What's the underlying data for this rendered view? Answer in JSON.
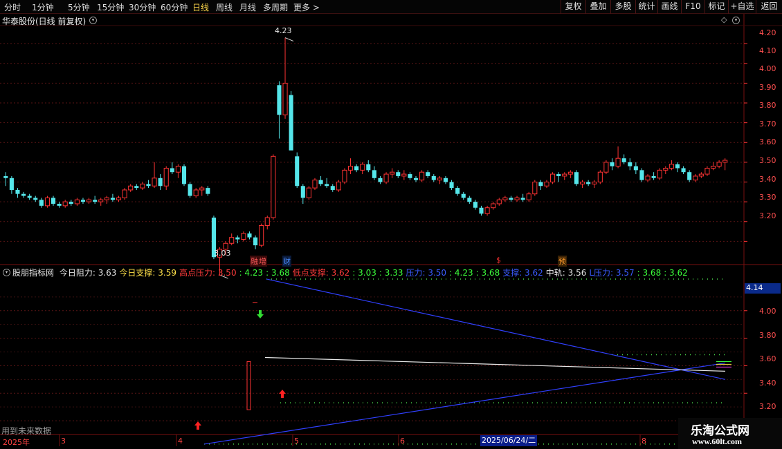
{
  "toolbar": {
    "periods": [
      "分时",
      "1分钟",
      "5分钟",
      "15分钟",
      "30分钟",
      "60分钟",
      "日线",
      "周线",
      "月线",
      "多周期",
      "更多 >"
    ],
    "active_period": "日线",
    "right_buttons": [
      "复权",
      "叠加",
      "多股",
      "统计",
      "画线",
      "F10",
      "标记",
      "+自选",
      "返回"
    ]
  },
  "main_panel": {
    "title": "华泰股份(日线 前复权)",
    "high_label": "4.23",
    "low_label": "3.03",
    "y_ticks": [
      "4.20",
      "4.10",
      "4.00",
      "3.90",
      "3.80",
      "3.70",
      "3.60",
      "3.50",
      "3.40",
      "3.30",
      "3.20"
    ],
    "events": [
      {
        "text": "融",
        "color": "#ff5a5a"
      },
      {
        "text": "增",
        "color": "#ff5a5a"
      },
      {
        "text": "财",
        "color": "#4a8cff"
      },
      {
        "text": "$",
        "color": "#ff3333"
      },
      {
        "text": "预",
        "color": "#ff9a2a"
      }
    ]
  },
  "indicator_panel": {
    "name": "股朋指标网",
    "items": [
      {
        "label": "今日阻力: 3.63",
        "color": "#e6e6e6"
      },
      {
        "label": "今日支撑: 3.59",
        "color": "#ffe14a"
      },
      {
        "label": "高点压力: 3.50",
        "color": "#ff3b3b"
      },
      {
        "label": ": 4.23",
        "color": "#3cff3c"
      },
      {
        "label": ": 3.68",
        "color": "#3cff3c"
      },
      {
        "label": "低点支撑: 3.62",
        "color": "#ff3b3b"
      },
      {
        "label": ": 3.03",
        "color": "#3cff3c"
      },
      {
        "label": ": 3.33",
        "color": "#3cff3c"
      },
      {
        "label": "压力: 3.50",
        "color": "#3a5cff"
      },
      {
        "label": ": 4.23",
        "color": "#3cff3c"
      },
      {
        "label": ": 3.68",
        "color": "#3cff3c"
      },
      {
        "label": "支撑: 3.62",
        "color": "#3a5cff"
      },
      {
        "label": "中轨: 3.56",
        "color": "#e6e6e6"
      },
      {
        "label": "L压力: 3.57",
        "color": "#3a5cff"
      },
      {
        "label": ": 3.68",
        "color": "#3cff3c"
      },
      {
        "label": ": 3.62",
        "color": "#3cff3c"
      }
    ],
    "current_value": "4.14",
    "y_ticks": [
      "4.00",
      "3.80",
      "3.60",
      "3.40",
      "3.20"
    ],
    "future_data_text": "用到未来数据"
  },
  "date_axis": {
    "labels": [
      "2025年",
      "3",
      "4",
      "5",
      "6",
      "8"
    ],
    "cursor_label": "2025/06/24/二"
  },
  "watermark": {
    "title": "乐淘公式网",
    "url": "www.60lt.com"
  },
  "colors": {
    "up": "#ff3333",
    "down": "#55e6ea",
    "axis": "#ff3333",
    "background": "#000000"
  },
  "chart_data": {
    "type": "candlestick",
    "price_range": [
      3.1,
      4.26
    ],
    "high": 4.23,
    "low": 3.03,
    "candles": [
      [
        3.53,
        3.55,
        3.48,
        3.52
      ],
      [
        3.52,
        3.53,
        3.44,
        3.46
      ],
      [
        3.46,
        3.47,
        3.42,
        3.44
      ],
      [
        3.44,
        3.45,
        3.42,
        3.43
      ],
      [
        3.43,
        3.44,
        3.41,
        3.42
      ],
      [
        3.42,
        3.43,
        3.4,
        3.41
      ],
      [
        3.41,
        3.42,
        3.37,
        3.38
      ],
      [
        3.38,
        3.43,
        3.37,
        3.42
      ],
      [
        3.42,
        3.43,
        3.38,
        3.39
      ],
      [
        3.39,
        3.4,
        3.37,
        3.38
      ],
      [
        3.38,
        3.41,
        3.37,
        3.4
      ],
      [
        3.4,
        3.41,
        3.38,
        3.39
      ],
      [
        3.39,
        3.42,
        3.38,
        3.41
      ],
      [
        3.41,
        3.42,
        3.39,
        3.4
      ],
      [
        3.4,
        3.42,
        3.39,
        3.41
      ],
      [
        3.41,
        3.43,
        3.39,
        3.4
      ],
      [
        3.4,
        3.42,
        3.38,
        3.41
      ],
      [
        3.41,
        3.43,
        3.39,
        3.42
      ],
      [
        3.42,
        3.44,
        3.4,
        3.41
      ],
      [
        3.41,
        3.43,
        3.4,
        3.42
      ],
      [
        3.42,
        3.47,
        3.41,
        3.46
      ],
      [
        3.46,
        3.49,
        3.45,
        3.48
      ],
      [
        3.48,
        3.49,
        3.46,
        3.47
      ],
      [
        3.47,
        3.5,
        3.46,
        3.49
      ],
      [
        3.49,
        3.51,
        3.47,
        3.48
      ],
      [
        3.48,
        3.6,
        3.47,
        3.52
      ],
      [
        3.52,
        3.54,
        3.46,
        3.48
      ],
      [
        3.48,
        3.58,
        3.46,
        3.57
      ],
      [
        3.57,
        3.6,
        3.54,
        3.55
      ],
      [
        3.55,
        3.59,
        3.52,
        3.58
      ],
      [
        3.58,
        3.59,
        3.48,
        3.49
      ],
      [
        3.49,
        3.5,
        3.42,
        3.43
      ],
      [
        3.43,
        3.47,
        3.42,
        3.46
      ],
      [
        3.46,
        3.48,
        3.43,
        3.47
      ],
      [
        3.47,
        3.48,
        3.43,
        3.44
      ],
      [
        3.32,
        3.33,
        3.11,
        3.12
      ],
      [
        3.12,
        3.17,
        3.03,
        3.16
      ],
      [
        3.16,
        3.2,
        3.13,
        3.19
      ],
      [
        3.19,
        3.24,
        3.18,
        3.22
      ],
      [
        3.22,
        3.23,
        3.19,
        3.21
      ],
      [
        3.21,
        3.25,
        3.2,
        3.24
      ],
      [
        3.24,
        3.25,
        3.21,
        3.22
      ],
      [
        3.22,
        3.23,
        3.16,
        3.18
      ],
      [
        3.18,
        3.29,
        3.17,
        3.28
      ],
      [
        3.28,
        3.33,
        3.26,
        3.32
      ],
      [
        3.32,
        3.64,
        3.31,
        3.63
      ],
      [
        3.99,
        4.01,
        3.72,
        3.84
      ],
      [
        3.84,
        4.23,
        3.82,
        4.0
      ],
      [
        3.94,
        3.96,
        3.72,
        3.66
      ],
      [
        3.63,
        3.65,
        3.47,
        3.48
      ],
      [
        3.48,
        3.49,
        3.39,
        3.42
      ],
      [
        3.42,
        3.48,
        3.41,
        3.47
      ],
      [
        3.47,
        3.52,
        3.46,
        3.51
      ],
      [
        3.51,
        3.53,
        3.48,
        3.49
      ],
      [
        3.49,
        3.52,
        3.47,
        3.48
      ],
      [
        3.48,
        3.49,
        3.45,
        3.46
      ],
      [
        3.46,
        3.51,
        3.45,
        3.5
      ],
      [
        3.5,
        3.57,
        3.49,
        3.56
      ],
      [
        3.56,
        3.62,
        3.54,
        3.58
      ],
      [
        3.58,
        3.59,
        3.55,
        3.56
      ],
      [
        3.56,
        3.6,
        3.54,
        3.59
      ],
      [
        3.59,
        3.61,
        3.55,
        3.56
      ],
      [
        3.56,
        3.58,
        3.51,
        3.52
      ],
      [
        3.52,
        3.53,
        3.49,
        3.5
      ],
      [
        3.5,
        3.55,
        3.49,
        3.54
      ],
      [
        3.54,
        3.57,
        3.52,
        3.55
      ],
      [
        3.55,
        3.56,
        3.52,
        3.53
      ],
      [
        3.53,
        3.56,
        3.51,
        3.54
      ],
      [
        3.54,
        3.55,
        3.51,
        3.52
      ],
      [
        3.52,
        3.53,
        3.5,
        3.51
      ],
      [
        3.51,
        3.56,
        3.5,
        3.55
      ],
      [
        3.55,
        3.56,
        3.52,
        3.53
      ],
      [
        3.53,
        3.54,
        3.5,
        3.51
      ],
      [
        3.51,
        3.53,
        3.49,
        3.52
      ],
      [
        3.52,
        3.53,
        3.49,
        3.5
      ],
      [
        3.5,
        3.51,
        3.46,
        3.47
      ],
      [
        3.47,
        3.48,
        3.43,
        3.44
      ],
      [
        3.44,
        3.45,
        3.41,
        3.42
      ],
      [
        3.42,
        3.43,
        3.39,
        3.4
      ],
      [
        3.4,
        3.41,
        3.36,
        3.37
      ],
      [
        3.37,
        3.38,
        3.33,
        3.34
      ],
      [
        3.34,
        3.38,
        3.33,
        3.37
      ],
      [
        3.37,
        3.4,
        3.36,
        3.39
      ],
      [
        3.39,
        3.42,
        3.38,
        3.41
      ],
      [
        3.41,
        3.43,
        3.4,
        3.42
      ],
      [
        3.42,
        3.43,
        3.4,
        3.41
      ],
      [
        3.41,
        3.43,
        3.4,
        3.42
      ],
      [
        3.42,
        3.44,
        3.4,
        3.41
      ],
      [
        3.41,
        3.45,
        3.4,
        3.44
      ],
      [
        3.44,
        3.51,
        3.43,
        3.5
      ],
      [
        3.5,
        3.51,
        3.46,
        3.48
      ],
      [
        3.48,
        3.51,
        3.47,
        3.5
      ],
      [
        3.5,
        3.55,
        3.49,
        3.54
      ],
      [
        3.54,
        3.55,
        3.5,
        3.53
      ],
      [
        3.53,
        3.55,
        3.51,
        3.54
      ],
      [
        3.54,
        3.56,
        3.52,
        3.55
      ],
      [
        3.55,
        3.56,
        3.48,
        3.49
      ],
      [
        3.49,
        3.51,
        3.47,
        3.5
      ],
      [
        3.5,
        3.51,
        3.48,
        3.49
      ],
      [
        3.49,
        3.51,
        3.47,
        3.5
      ],
      [
        3.5,
        3.56,
        3.49,
        3.55
      ],
      [
        3.55,
        3.61,
        3.54,
        3.6
      ],
      [
        3.6,
        3.62,
        3.56,
        3.58
      ],
      [
        3.58,
        3.68,
        3.57,
        3.62
      ],
      [
        3.62,
        3.64,
        3.59,
        3.6
      ],
      [
        3.6,
        3.62,
        3.56,
        3.58
      ],
      [
        3.58,
        3.6,
        3.54,
        3.56
      ],
      [
        3.56,
        3.57,
        3.5,
        3.51
      ],
      [
        3.51,
        3.54,
        3.5,
        3.53
      ],
      [
        3.53,
        3.55,
        3.51,
        3.52
      ],
      [
        3.52,
        3.57,
        3.51,
        3.56
      ],
      [
        3.56,
        3.58,
        3.54,
        3.57
      ],
      [
        3.57,
        3.61,
        3.56,
        3.59
      ],
      [
        3.59,
        3.6,
        3.55,
        3.57
      ],
      [
        3.57,
        3.58,
        3.54,
        3.55
      ],
      [
        3.55,
        3.56,
        3.5,
        3.51
      ],
      [
        3.51,
        3.54,
        3.5,
        3.53
      ],
      [
        3.53,
        3.55,
        3.52,
        3.54
      ],
      [
        3.54,
        3.58,
        3.53,
        3.57
      ],
      [
        3.57,
        3.6,
        3.56,
        3.58
      ],
      [
        3.58,
        3.61,
        3.57,
        3.6
      ],
      [
        3.6,
        3.62,
        3.56,
        3.61
      ]
    ],
    "indicator": {
      "range": [
        3.12,
        4.26
      ],
      "descending_line": [
        4.23,
        3.5
      ],
      "ascending_line": [
        3.03,
        3.62
      ],
      "middle_line": [
        3.66,
        3.56
      ],
      "dotted_levels": [
        4.23,
        3.68,
        3.33,
        3.03
      ]
    }
  }
}
